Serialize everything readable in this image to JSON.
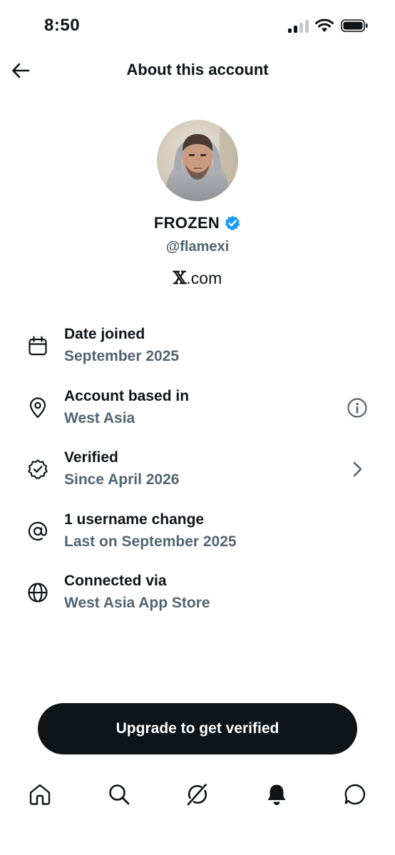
{
  "status_bar": {
    "time": "8:50",
    "icons": [
      "signal-icon",
      "wifi-icon",
      "battery-icon"
    ]
  },
  "header": {
    "title": "About this account",
    "back_icon": "arrow-left-icon"
  },
  "profile": {
    "display_name": "FROZEN",
    "verified": true,
    "verified_color": "#1d9bf0",
    "handle": "@flamexi",
    "site_x": "𝕏",
    "site_rest": ".com"
  },
  "details": [
    {
      "icon": "calendar-icon",
      "title": "Date joined",
      "value": "September 2025"
    },
    {
      "icon": "location-pin-icon",
      "title": "Account based in",
      "value": "West Asia",
      "trailing_icon": "info-icon"
    },
    {
      "icon": "verified-badge-outline-icon",
      "title": "Verified",
      "value": "Since April 2026",
      "trailing_icon": "chevron-right-icon"
    },
    {
      "icon": "at-sign-icon",
      "title": "1 username change",
      "value": "Last on September 2025"
    },
    {
      "icon": "globe-icon",
      "title": "Connected via",
      "value": "West Asia App Store"
    }
  ],
  "cta": {
    "label": "Upgrade to get verified"
  },
  "tab_bar": {
    "tabs": [
      "home-icon",
      "search-icon",
      "grok-icon",
      "notifications-icon",
      "messages-icon"
    ],
    "active": "notifications-icon"
  },
  "colors": {
    "text": "#0f1419",
    "secondary": "#536471",
    "accent": "#1d9bf0",
    "button": "#0f1419"
  }
}
